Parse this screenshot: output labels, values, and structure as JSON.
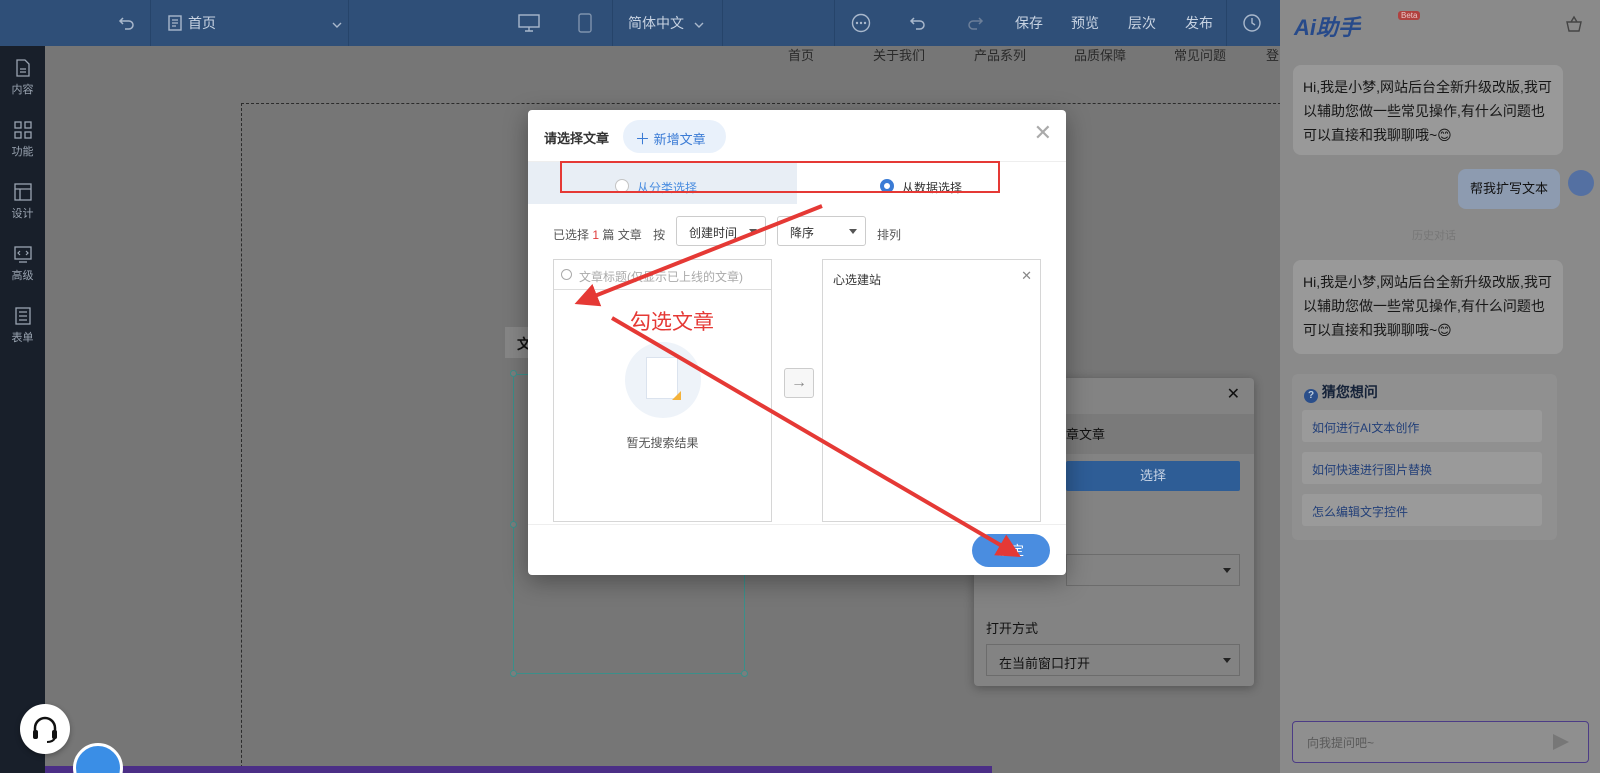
{
  "topbar": {
    "page_select": "首页",
    "language": "简体中文",
    "actions": [
      "保存",
      "预览",
      "层次",
      "发布"
    ]
  },
  "leftnav": {
    "items": [
      "内容",
      "功能",
      "设计",
      "高级",
      "表单"
    ]
  },
  "canvas": {
    "site_nav": [
      "首页",
      "关于我们",
      "产品系列",
      "品质保障",
      "常见问题",
      "登"
    ],
    "label_tab": "文"
  },
  "props": {
    "row_label": "章文章",
    "select_button": "选择",
    "open_label": "打开方式",
    "open_value": "在当前窗口打开"
  },
  "ai": {
    "title": "Ai助手",
    "beta": "Beta",
    "welcome": "Hi,我是小梦,网站后台全新升级改版,我可以辅助您做一些常见操作,有什么问题也可以直接和我聊聊哦~😊",
    "user_msg": "帮我扩写文本",
    "history_label": "历史对话",
    "welcome2": "Hi,我是小梦,网站后台全新升级改版,我可以辅助您做一些常见操作,有什么问题也可以直接和我聊聊哦~😊",
    "guess_title": "猜您想问",
    "guess_items": [
      "如何进行AI文本创作",
      "如何快速进行图片替换",
      "怎么编辑文字控件"
    ],
    "input_placeholder": "向我提问吧~"
  },
  "modal": {
    "title": "请选择文章",
    "add_button": "新增文章",
    "tab_category": "从分类选择",
    "tab_data": "从数据选择",
    "info_prefix": "已选择",
    "info_count": "1",
    "info_suffix": "篇 文章",
    "sort_by": "按",
    "sort_field": "创建时间",
    "sort_order": "降序",
    "sort_suffix": "排列",
    "search_placeholder": "文章标题(仅显示已上线的文章)",
    "empty_text": "暂无搜索结果",
    "selected_item": "心选建站",
    "ok_button": "确定"
  },
  "annotation": {
    "text": "勾选文章",
    "color": "#e53935"
  }
}
